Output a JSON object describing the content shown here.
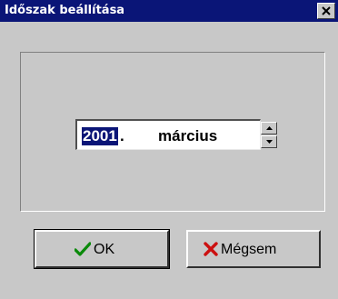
{
  "window": {
    "title": "Időszak beállítása"
  },
  "date_picker": {
    "year": "2001",
    "separator": ".",
    "month": "március"
  },
  "buttons": {
    "ok_label": "OK",
    "cancel_label": "Mégsem"
  },
  "icons": {
    "close": "close-icon",
    "ok": "checkmark-icon",
    "cancel": "x-icon",
    "spin_up": "arrow-up-icon",
    "spin_down": "arrow-down-icon"
  },
  "colors": {
    "titlebar": "#0a1577",
    "face": "#c8c8c8",
    "selection": "#0a1577",
    "ok_icon": "#0a8a0a",
    "cancel_icon": "#cc1010"
  }
}
